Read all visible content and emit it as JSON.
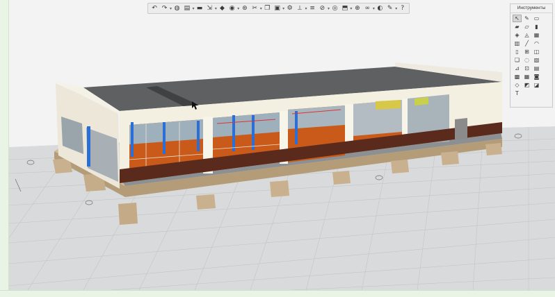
{
  "window": {
    "viewport": "3d-model-view"
  },
  "toolbar": {
    "buttons": [
      {
        "name": "undo-icon",
        "glyph": "↶"
      },
      {
        "name": "redo-icon",
        "glyph": "↷"
      },
      {
        "name": "camera-icon",
        "glyph": "◍"
      },
      {
        "name": "open-icon",
        "glyph": "▤"
      },
      {
        "name": "save-icon",
        "glyph": "▬"
      },
      {
        "name": "import-icon",
        "glyph": "⇲"
      },
      {
        "name": "layer-icon",
        "glyph": "◆"
      },
      {
        "name": "render-icon",
        "glyph": "◉"
      },
      {
        "name": "target-icon",
        "glyph": "⊛"
      },
      {
        "name": "cut-icon",
        "glyph": "✂"
      },
      {
        "name": "copy-icon",
        "glyph": "❐"
      },
      {
        "name": "paste-icon",
        "glyph": "▣"
      },
      {
        "name": "properties-icon",
        "glyph": "⚙"
      },
      {
        "name": "measure-icon",
        "glyph": "⟂"
      },
      {
        "name": "list-icon",
        "glyph": "≡"
      },
      {
        "name": "hide-icon",
        "glyph": "⊘"
      },
      {
        "name": "eye-icon",
        "glyph": "◎"
      },
      {
        "name": "section-icon",
        "glyph": "⬒"
      },
      {
        "name": "snap-icon",
        "glyph": "⊕"
      },
      {
        "name": "link-icon",
        "glyph": "∞"
      },
      {
        "name": "view-icon",
        "glyph": "◐"
      },
      {
        "name": "wrench-icon",
        "glyph": "✎"
      },
      {
        "name": "help-icon",
        "glyph": "?"
      }
    ]
  },
  "tools_panel": {
    "title": "Инструменты",
    "tools": [
      {
        "name": "select-tool-icon",
        "glyph": "↖"
      },
      {
        "name": "pencil-tool-icon",
        "glyph": "✎"
      },
      {
        "name": "rectangle-tool-icon",
        "glyph": "▭"
      },
      {
        "name": "blank-tool",
        "glyph": ""
      },
      {
        "name": "wall-tool-icon",
        "glyph": "▰"
      },
      {
        "name": "slab-tool-icon",
        "glyph": "▱"
      },
      {
        "name": "column-tool-icon",
        "glyph": "▮"
      },
      {
        "name": "blank-tool-2",
        "glyph": ""
      },
      {
        "name": "beam-tool-icon",
        "glyph": "◈"
      },
      {
        "name": "roof-tool-icon",
        "glyph": "◬"
      },
      {
        "name": "stair-tool-icon",
        "glyph": "▦"
      },
      {
        "name": "blank-tool-3",
        "glyph": ""
      },
      {
        "name": "railing-tool-icon",
        "glyph": "▥"
      },
      {
        "name": "line-tool-icon",
        "glyph": "╱"
      },
      {
        "name": "arc-tool-icon",
        "glyph": "◠"
      },
      {
        "name": "blank-tool-4",
        "glyph": ""
      },
      {
        "name": "door-tool-icon",
        "glyph": "▯"
      },
      {
        "name": "window-tool-icon",
        "glyph": "⊞"
      },
      {
        "name": "opening-tool-icon",
        "glyph": "◫"
      },
      {
        "name": "blank-tool-5",
        "glyph": ""
      },
      {
        "name": "object-tool-icon",
        "glyph": "❏"
      },
      {
        "name": "lamp-tool-icon",
        "glyph": "◌"
      },
      {
        "name": "zone-tool-icon",
        "glyph": "▧"
      },
      {
        "name": "blank-tool-6",
        "glyph": ""
      },
      {
        "name": "dimension-tool-icon",
        "glyph": "⊿"
      },
      {
        "name": "level-tool-icon",
        "glyph": "⊡"
      },
      {
        "name": "label-tool-icon",
        "glyph": "▤"
      },
      {
        "name": "blank-tool-7",
        "glyph": ""
      },
      {
        "name": "mesh-tool-icon",
        "glyph": "▩"
      },
      {
        "name": "grid-tool-icon",
        "glyph": "▦"
      },
      {
        "name": "camera-tool-icon",
        "glyph": "◙"
      },
      {
        "name": "blank-tool-8",
        "glyph": ""
      },
      {
        "name": "figure-tool-icon",
        "glyph": "◇"
      },
      {
        "name": "detail-tool-icon",
        "glyph": "◩"
      },
      {
        "name": "worksheet-tool-icon",
        "glyph": "◪"
      },
      {
        "name": "blank-tool-9",
        "glyph": ""
      },
      {
        "name": "text-tool-icon",
        "glyph": "T"
      }
    ]
  },
  "colors": {
    "floor": "#dcdcdc",
    "grid": "#c8c8c8",
    "roof": "#5e6062",
    "wall": "#f3efe1",
    "orange": "#c95a1a",
    "blue": "#2b6fd6",
    "brown": "#5a2a1c",
    "footing": "#c9b08e"
  }
}
